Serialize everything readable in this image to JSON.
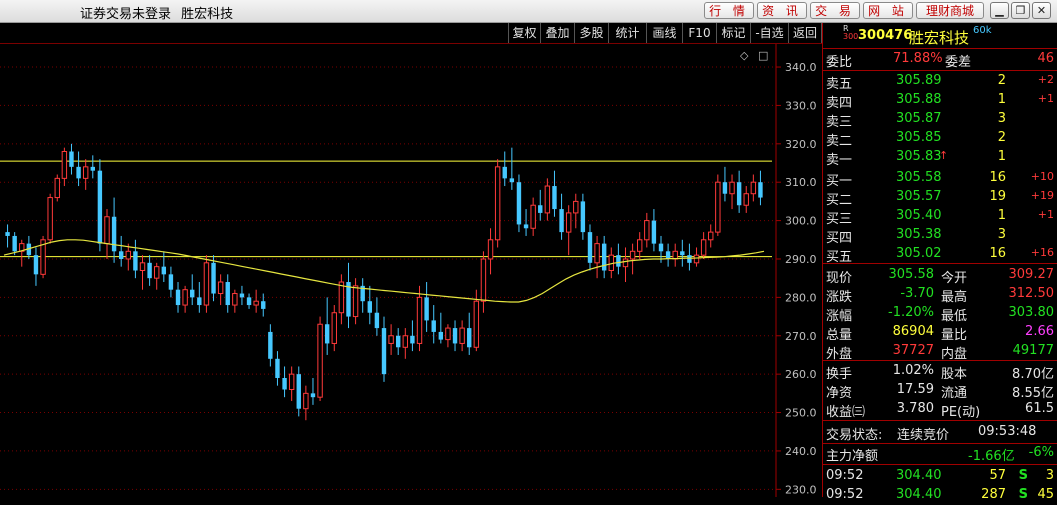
{
  "window": {
    "title_status": "证券交易未登录",
    "title_stock": "胜宏科技",
    "top_buttons": [
      "行 情",
      "资 讯",
      "交 易",
      "网 站",
      "理财商城"
    ]
  },
  "toolbar": [
    "复权",
    "叠加",
    "多股",
    "统计",
    "画线",
    "F10",
    "标记",
    "-自选",
    "返回"
  ],
  "chart_data": {
    "type": "candlestick",
    "period": "60k",
    "yticks": [
      340,
      330,
      320,
      310,
      300,
      290,
      280,
      270,
      260,
      250,
      240,
      230
    ],
    "ylim": [
      228,
      346
    ],
    "h_lines": [
      315.5,
      290.6
    ],
    "colors": {
      "up": "#ff3a3a",
      "down": "#46c8ff",
      "ma": "#e6e640",
      "hline": "#ffff3c",
      "grid": "#7a0000"
    },
    "candles": [
      [
        297,
        299,
        293,
        296
      ],
      [
        296,
        297,
        291,
        292
      ],
      [
        292,
        295,
        288,
        294
      ],
      [
        294,
        296,
        290,
        291
      ],
      [
        291,
        293,
        283,
        286
      ],
      [
        286,
        296,
        285,
        295
      ],
      [
        295,
        307,
        294,
        306
      ],
      [
        306,
        312,
        305,
        311
      ],
      [
        311,
        319,
        309,
        318
      ],
      [
        318,
        320,
        312,
        314
      ],
      [
        314,
        318,
        309,
        311
      ],
      [
        311,
        316,
        308,
        314
      ],
      [
        314,
        317,
        311,
        313
      ],
      [
        313,
        316,
        292,
        294
      ],
      [
        294,
        303,
        290,
        301
      ],
      [
        301,
        306,
        289,
        292
      ],
      [
        292,
        296,
        288,
        290
      ],
      [
        290,
        294,
        287,
        292
      ],
      [
        292,
        295,
        285,
        287
      ],
      [
        287,
        291,
        282,
        289
      ],
      [
        289,
        291,
        283,
        285
      ],
      [
        285,
        289,
        282,
        288
      ],
      [
        288,
        292,
        284,
        286
      ],
      [
        286,
        288,
        280,
        282
      ],
      [
        282,
        284,
        276,
        278
      ],
      [
        278,
        283,
        276,
        282
      ],
      [
        282,
        286,
        278,
        280
      ],
      [
        280,
        284,
        276,
        278
      ],
      [
        278,
        291,
        276,
        289
      ],
      [
        289,
        291,
        279,
        281
      ],
      [
        281,
        286,
        278,
        284
      ],
      [
        284,
        286,
        276,
        278
      ],
      [
        278,
        282,
        276,
        281
      ],
      [
        281,
        283,
        278,
        280
      ],
      [
        280,
        281,
        277,
        278
      ],
      [
        278,
        282,
        276,
        279
      ],
      [
        279,
        281,
        275,
        277
      ],
      [
        271,
        273,
        262,
        264
      ],
      [
        264,
        266,
        257,
        259
      ],
      [
        259,
        262,
        254,
        256
      ],
      [
        256,
        262,
        253,
        260
      ],
      [
        260,
        262,
        249,
        251
      ],
      [
        251,
        257,
        248,
        255
      ],
      [
        255,
        259,
        252,
        254
      ],
      [
        254,
        275,
        253,
        273
      ],
      [
        273,
        280,
        265,
        268
      ],
      [
        268,
        278,
        266,
        276
      ],
      [
        276,
        286,
        273,
        284
      ],
      [
        284,
        289,
        272,
        275
      ],
      [
        275,
        285,
        273,
        283
      ],
      [
        283,
        285,
        276,
        279
      ],
      [
        279,
        283,
        273,
        276
      ],
      [
        276,
        280,
        270,
        272
      ],
      [
        272,
        275,
        258,
        260
      ],
      [
        268,
        273,
        265,
        270
      ],
      [
        270,
        272,
        265,
        267
      ],
      [
        267,
        272,
        264,
        270
      ],
      [
        270,
        274,
        266,
        268
      ],
      [
        268,
        283,
        266,
        280
      ],
      [
        280,
        284,
        271,
        274
      ],
      [
        274,
        278,
        268,
        271
      ],
      [
        271,
        276,
        268,
        269
      ],
      [
        269,
        273,
        267,
        272
      ],
      [
        272,
        274,
        266,
        268
      ],
      [
        268,
        274,
        266,
        272
      ],
      [
        272,
        276,
        265,
        267
      ],
      [
        267,
        282,
        266,
        279
      ],
      [
        279,
        292,
        276,
        290
      ],
      [
        290,
        298,
        286,
        295
      ],
      [
        295,
        316,
        293,
        314
      ],
      [
        314,
        318,
        309,
        311
      ],
      [
        311,
        319,
        308,
        310
      ],
      [
        310,
        312,
        297,
        299
      ],
      [
        299,
        303,
        296,
        298
      ],
      [
        298,
        306,
        296,
        304
      ],
      [
        304,
        308,
        300,
        302
      ],
      [
        302,
        311,
        300,
        309
      ],
      [
        309,
        313,
        301,
        303
      ],
      [
        303,
        307,
        295,
        297
      ],
      [
        297,
        304,
        291,
        302
      ],
      [
        302,
        307,
        298,
        305
      ],
      [
        305,
        307,
        295,
        297
      ],
      [
        297,
        299,
        287,
        289
      ],
      [
        289,
        296,
        285,
        294
      ],
      [
        294,
        296,
        285,
        287
      ],
      [
        287,
        293,
        285,
        291
      ],
      [
        291,
        294,
        286,
        288
      ],
      [
        288,
        293,
        284,
        290
      ],
      [
        290,
        294,
        286,
        292
      ],
      [
        292,
        297,
        290,
        295
      ],
      [
        295,
        302,
        293,
        300
      ],
      [
        300,
        303,
        292,
        294
      ],
      [
        294,
        296,
        289,
        292
      ],
      [
        292,
        294,
        288,
        290
      ],
      [
        290,
        294,
        288,
        292
      ],
      [
        292,
        295,
        288,
        291
      ],
      [
        291,
        294,
        287,
        289
      ],
      [
        289,
        293,
        288,
        291
      ],
      [
        291,
        297,
        290,
        295
      ],
      [
        295,
        299,
        293,
        297
      ],
      [
        297,
        312,
        296,
        310
      ],
      [
        310,
        314,
        305,
        307
      ],
      [
        307,
        312,
        303,
        310
      ],
      [
        310,
        313,
        302,
        304
      ],
      [
        304,
        309,
        302,
        307
      ],
      [
        307,
        312,
        305,
        310
      ],
      [
        310,
        313,
        304,
        306
      ]
    ],
    "ma": [
      291,
      291.5,
      292,
      292.6,
      293.2,
      293.8,
      294.4,
      294.8,
      295,
      295,
      294.9,
      294.6,
      294.3,
      294,
      293.7,
      293.4,
      293.1,
      292.8,
      292.5,
      292.2,
      291.9,
      291.6,
      291.3,
      290.9,
      290.5,
      290.1,
      289.7,
      289.3,
      288.9,
      288.5,
      288.1,
      287.7,
      287.3,
      286.9,
      286.5,
      286.1,
      285.7,
      285.3,
      284.9,
      284.5,
      284.1,
      283.7,
      283.3,
      282.9,
      282.6,
      282.4,
      282.2,
      282,
      281.8,
      281.6,
      281.4,
      281.2,
      281,
      280.8,
      280.6,
      280.4,
      280.2,
      280,
      279.8,
      279.6,
      279.4,
      279.2,
      279,
      278.9,
      278.8,
      278.8,
      279.2,
      280,
      281,
      282.3,
      283.6,
      284.8,
      285.8,
      286.6,
      287.3,
      287.9,
      288.4,
      288.9,
      289.2,
      289.5,
      289.7,
      289.9,
      290,
      290,
      290.1,
      290.1,
      290.2,
      290.2,
      290.3,
      290.4,
      290.5,
      290.6,
      290.8,
      291,
      291.3,
      291.6,
      292
    ]
  },
  "quote": {
    "market_tag_top": "R",
    "market_tag_bottom": "300",
    "code": "300476",
    "name": "胜宏科技",
    "period": "60k",
    "weibi_label": "委比",
    "weibi": "71.88%",
    "weicha_label": "委差",
    "weicha": "46",
    "sell": [
      {
        "label": "卖五",
        "price": "305.89",
        "vol": "2",
        "chg": "+2"
      },
      {
        "label": "卖四",
        "price": "305.88",
        "vol": "1",
        "chg": "+1"
      },
      {
        "label": "卖三",
        "price": "305.87",
        "vol": "3",
        "chg": ""
      },
      {
        "label": "卖二",
        "price": "305.85",
        "vol": "2",
        "chg": ""
      },
      {
        "label": "卖一",
        "price": "305.83",
        "vol": "1",
        "chg": ""
      }
    ],
    "buy": [
      {
        "label": "买一",
        "price": "305.58",
        "vol": "16",
        "chg": "+10"
      },
      {
        "label": "买二",
        "price": "305.57",
        "vol": "19",
        "chg": "+19"
      },
      {
        "label": "买三",
        "price": "305.40",
        "vol": "1",
        "chg": "+1"
      },
      {
        "label": "买四",
        "price": "305.38",
        "vol": "3",
        "chg": ""
      },
      {
        "label": "买五",
        "price": "305.02",
        "vol": "16",
        "chg": "+16"
      }
    ],
    "stats": [
      {
        "l1": "现价",
        "v1": "305.58",
        "l2": "今开",
        "v2": "309.27"
      },
      {
        "l1": "涨跌",
        "v1": "-3.70",
        "l2": "最高",
        "v2": "312.50"
      },
      {
        "l1": "涨幅",
        "v1": "-1.20%",
        "l2": "最低",
        "v2": "303.80"
      },
      {
        "l1": "总量",
        "v1": "86904",
        "l2": "量比",
        "v2": "2.66"
      },
      {
        "l1": "外盘",
        "v1": "37727",
        "l2": "内盘",
        "v2": "49177"
      }
    ],
    "fund": [
      {
        "l1": "换手",
        "v1": "1.02%",
        "l2": "股本",
        "v2": "8.70亿"
      },
      {
        "l1": "净资",
        "v1": "17.59",
        "l2": "流通",
        "v2": "8.55亿"
      },
      {
        "l1": "收益㈢",
        "v1": "3.780",
        "l2": "PE(动)",
        "v2": "61.5"
      }
    ],
    "trade_state_label": "交易状态:",
    "trade_state": "连续竞价",
    "trade_time": "09:53:48",
    "main_flow_label": "主力净额",
    "main_flow": "-1.66亿",
    "main_flow_pct": "-6%",
    "ticks": [
      {
        "time": "09:52",
        "price": "304.40",
        "vol": "57",
        "side": "S",
        "n": "3"
      },
      {
        "time": "09:52",
        "price": "304.40",
        "vol": "287",
        "side": "S",
        "n": "45"
      }
    ]
  }
}
